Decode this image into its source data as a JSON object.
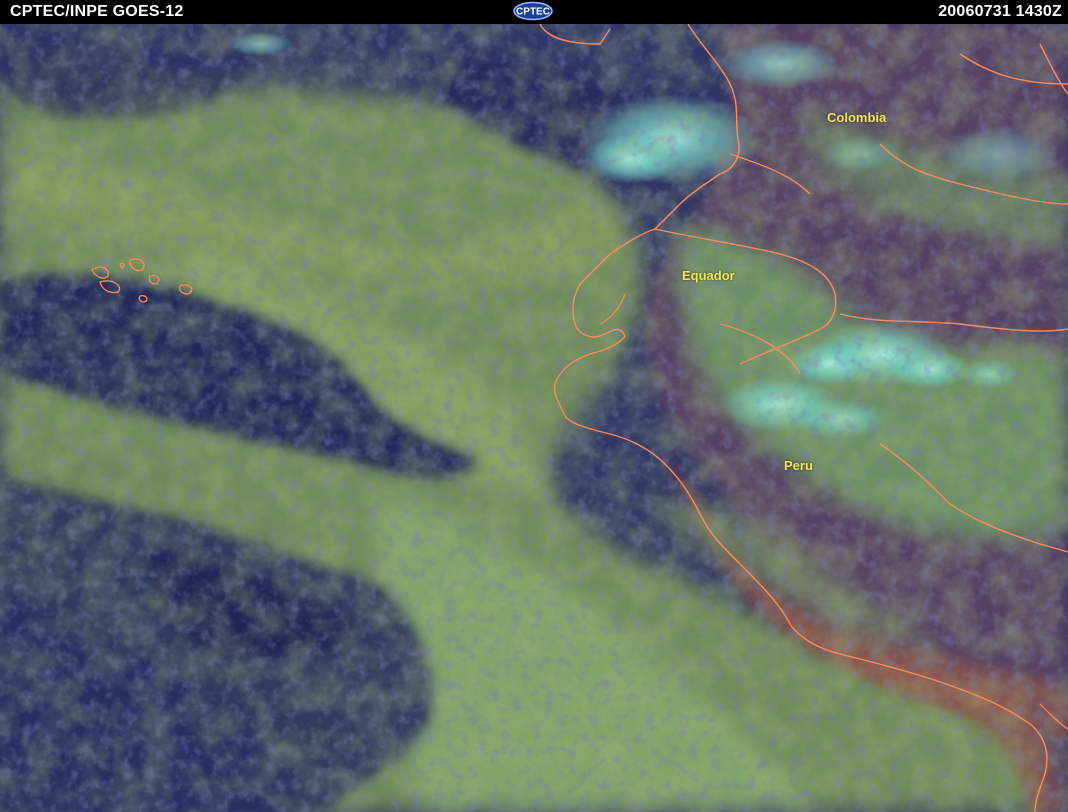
{
  "header": {
    "source": "CPTEC/INPE  GOES-12",
    "timestamp": "20060731  1430Z",
    "logo_text": "CPTEC"
  },
  "labels": {
    "colombia": "Colombia",
    "equador": "Equador",
    "peru": "Peru"
  },
  "colors": {
    "ocean_clear": "#2f3566",
    "low_cloud": "#7f9f5e",
    "high_cloud": "#8fe0d6",
    "coastline": "#ff8c5a",
    "label": "#f2e85a"
  }
}
